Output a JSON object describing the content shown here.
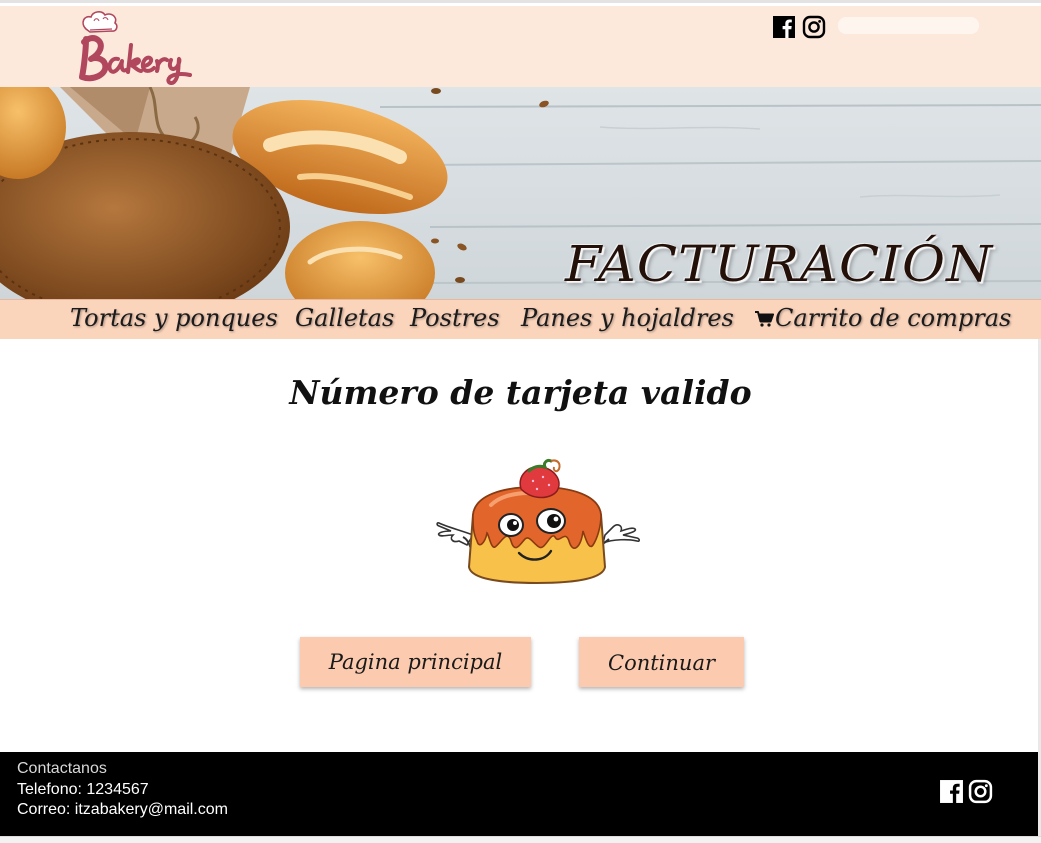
{
  "header": {
    "logo_text": "Bakery",
    "search": {
      "value": "",
      "placeholder": ""
    },
    "social": [
      "facebook-icon",
      "instagram-icon"
    ]
  },
  "banner": {
    "title": "FACTURACIÓN"
  },
  "nav": {
    "items": [
      {
        "label": "Tortas y ponques"
      },
      {
        "label": "Galletas"
      },
      {
        "label": "Postres"
      },
      {
        "label": "Panes y hojaldres"
      },
      {
        "label": "Carrito de compras",
        "icon": "cart-icon"
      }
    ]
  },
  "main": {
    "title": "Número de tarjeta valido",
    "buttons": {
      "home": "Pagina principal",
      "continue": "Continuar"
    }
  },
  "footer": {
    "contact_heading": "Contactanos",
    "phone": "Telefono: 1234567",
    "email": "Correo: itzabakery@mail.com",
    "social": [
      "facebook-icon",
      "instagram-icon"
    ]
  },
  "colors": {
    "header_bg": "#fde8dc",
    "nav_bg": "#fbd4bc",
    "button_bg": "#fccaae",
    "footer_bg": "#000000",
    "logo": "#b0475d"
  }
}
